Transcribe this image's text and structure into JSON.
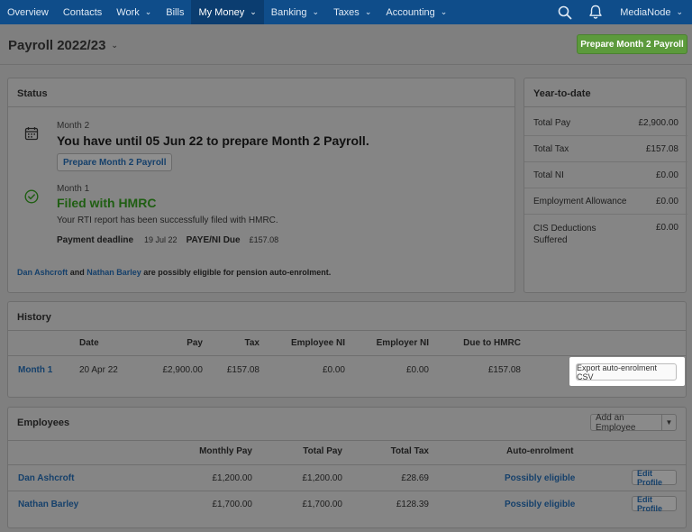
{
  "nav": {
    "items": [
      {
        "label": "Overview",
        "dropdown": false
      },
      {
        "label": "Contacts",
        "dropdown": false
      },
      {
        "label": "Work",
        "dropdown": true
      },
      {
        "label": "Bills",
        "dropdown": false
      },
      {
        "label": "My Money",
        "dropdown": true,
        "active": true
      },
      {
        "label": "Banking",
        "dropdown": true
      },
      {
        "label": "Taxes",
        "dropdown": true
      },
      {
        "label": "Accounting",
        "dropdown": true
      }
    ],
    "search_icon": "search-icon",
    "bell_icon": "bell-icon",
    "org_name": "MediaNode"
  },
  "header": {
    "title": "Payroll 2022/23",
    "primary_button": "Prepare Month 2 Payroll"
  },
  "status": {
    "heading": "Status",
    "upcoming": {
      "period": "Month 2",
      "message": "You have until 05 Jun 22 to prepare Month 2 Payroll.",
      "button": "Prepare Month 2 Payroll"
    },
    "filed": {
      "period": "Month 1",
      "title": "Filed with HMRC",
      "message": "Your RTI report has been successfully filed with HMRC.",
      "deadline_label": "Payment deadline",
      "deadline_value": "19 Jul 22",
      "paye_label": "PAYE/NI Due",
      "paye_value": "£157.08"
    },
    "pension": {
      "name1": "Dan Ashcroft",
      "and": "and",
      "name2": "Nathan Barley",
      "suffix": "are possibly eligible for pension auto-enrolment."
    }
  },
  "ytd": {
    "heading": "Year-to-date",
    "rows": [
      {
        "label": "Total Pay",
        "value": "£2,900.00"
      },
      {
        "label": "Total Tax",
        "value": "£157.08"
      },
      {
        "label": "Total NI",
        "value": "£0.00"
      },
      {
        "label": "Employment Allowance",
        "value": "£0.00"
      },
      {
        "label": "CIS Deductions Suffered",
        "value": "£0.00"
      }
    ]
  },
  "history": {
    "heading": "History",
    "columns": [
      "Date",
      "Pay",
      "Tax",
      "Employee NI",
      "Employer NI",
      "Due to HMRC"
    ],
    "rows": [
      {
        "period": "Month 1",
        "date": "20 Apr 22",
        "pay": "£2,900.00",
        "tax": "£157.08",
        "employee_ni": "£0.00",
        "employer_ni": "£0.00",
        "due": "£157.08"
      }
    ],
    "export_button": "Export auto-enrolment CSV"
  },
  "employees": {
    "heading": "Employees",
    "add_button": "Add an Employee",
    "columns": [
      "Monthly Pay",
      "Total Pay",
      "Total Tax",
      "Auto-enrolment"
    ],
    "rows": [
      {
        "name": "Dan Ashcroft",
        "monthly": "£1,200.00",
        "total": "£1,200.00",
        "tax": "£28.69",
        "status": "Possibly eligible",
        "edit": "Edit Profile"
      },
      {
        "name": "Nathan Barley",
        "monthly": "£1,700.00",
        "total": "£1,700.00",
        "tax": "£128.39",
        "status": "Possibly eligible",
        "edit": "Edit Profile"
      }
    ]
  },
  "colors": {
    "nav_bg": "#0f4d8a",
    "primary_green": "#5c9a3c",
    "link_blue": "#15406b",
    "filed_green": "#1f5e12"
  }
}
